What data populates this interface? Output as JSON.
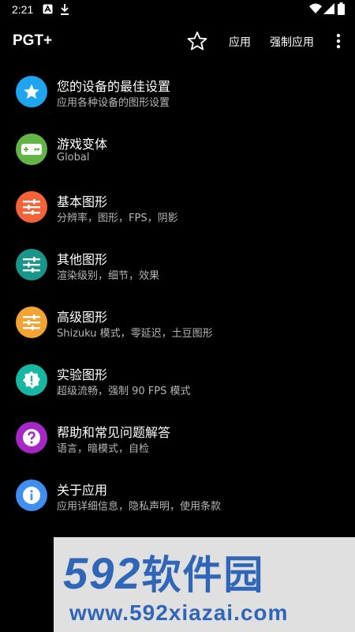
{
  "status_bar": {
    "time": "2:21"
  },
  "app_bar": {
    "title": "PGT+",
    "apply_label": "应用",
    "force_apply_label": "强制应用"
  },
  "menu_items": [
    {
      "title": "您的设备的最佳设置",
      "subtitle": "应用各种设备的图形设置",
      "icon": "star-icon",
      "color": "#1fa4f0"
    },
    {
      "title": "游戏变体",
      "subtitle": "Global",
      "icon": "gamepad-icon",
      "color": "#62b546"
    },
    {
      "title": "基本图形",
      "subtitle": "分辨率，图形，FPS，阴影",
      "icon": "sliders-icon",
      "color": "#f4623a"
    },
    {
      "title": "其他图形",
      "subtitle": "渲染级别，细节，效果",
      "icon": "sliders-icon",
      "color": "#18968a"
    },
    {
      "title": "高级图形",
      "subtitle": "Shizuku 模式，零延迟，土豆图形",
      "icon": "sliders-icon",
      "color": "#f2a333"
    },
    {
      "title": "实验图形",
      "subtitle": "超级流畅，强制 90 FPS 模式",
      "icon": "alert-badge-icon",
      "color": "#17b7a4"
    },
    {
      "title": "帮助和常见问题解答",
      "subtitle": "语言，暗模式，自检",
      "icon": "help-icon",
      "color": "#a626c6"
    },
    {
      "title": "关于应用",
      "subtitle": "应用详细信息，隐私声明，使用条款",
      "icon": "info-icon",
      "color": "#3f8ef0"
    }
  ],
  "watermark": {
    "logo_digits": "592",
    "logo_text": "软件园",
    "url": "www.592xiazai.com"
  }
}
